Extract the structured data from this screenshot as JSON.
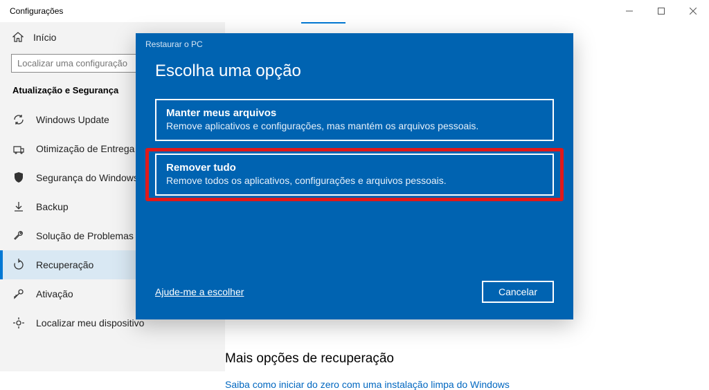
{
  "titlebar": {
    "title": "Configurações"
  },
  "sidebar": {
    "home_label": "Início",
    "search_placeholder": "Localizar uma configuração",
    "section": "Atualização e Segurança",
    "items": [
      {
        "label": "Windows Update"
      },
      {
        "label": "Otimização de Entrega"
      },
      {
        "label": "Segurança do Windows"
      },
      {
        "label": "Backup"
      },
      {
        "label": "Solução de Problemas"
      },
      {
        "label": "Recuperação"
      },
      {
        "label": "Ativação"
      },
      {
        "label": "Localizar meu dispositivo"
      }
    ]
  },
  "content": {
    "more_title": "Mais opções de recuperação",
    "more_link": "Saiba como iniciar do zero com uma instalação limpa do Windows"
  },
  "dialog": {
    "header": "Restaurar o PC",
    "title": "Escolha uma opção",
    "option1": {
      "title": "Manter meus arquivos",
      "desc": "Remove aplicativos e configurações, mas mantém os arquivos pessoais."
    },
    "option2": {
      "title": "Remover tudo",
      "desc": "Remove todos os aplicativos, configurações e arquivos pessoais."
    },
    "help": "Ajude-me a escolher",
    "cancel": "Cancelar"
  }
}
